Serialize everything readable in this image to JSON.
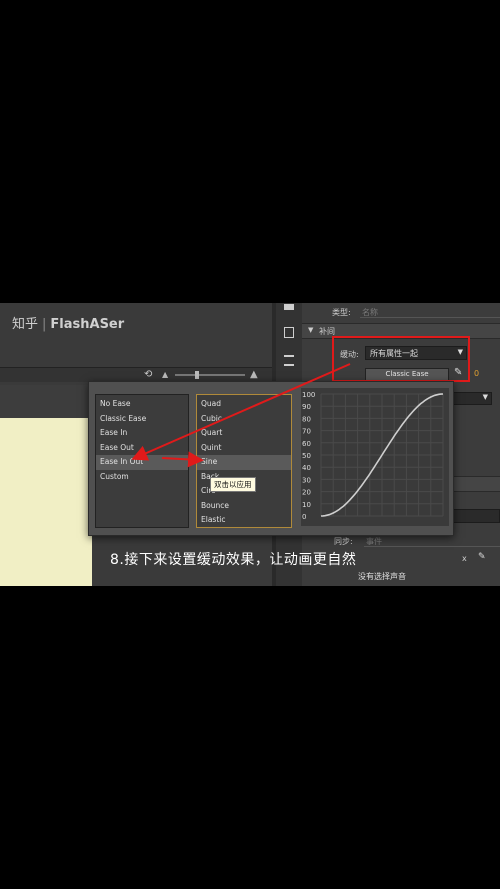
{
  "watermark": {
    "site": "知乎",
    "author": "FlashASer"
  },
  "properties": {
    "type_label": "类型:",
    "type_value": "名称",
    "section_label": "补间",
    "ease_label": "缓动:",
    "ease_value": "所有属性一起",
    "ease_button": "Classic Ease",
    "ease_amount": "0",
    "sync_label": "同步:",
    "sync_value": "事件",
    "x_label": "x",
    "no_sound": "没有选择声音"
  },
  "ease_popup": {
    "ease_types": [
      "No Ease",
      "Classic Ease",
      "Ease In",
      "Ease Out",
      "Ease In Out",
      "Custom"
    ],
    "selected_type": "Ease In Out",
    "curves": [
      "Quad",
      "Cubic",
      "Quart",
      "Quint",
      "Sine",
      "Back",
      "Circ",
      "Bounce",
      "Elastic"
    ],
    "selected_curve": "Sine",
    "tooltip": "双击以应用",
    "graph_labels": [
      "100",
      "90",
      "80",
      "70",
      "60",
      "50",
      "40",
      "30",
      "20",
      "10",
      "0"
    ]
  },
  "caption": "8.接下来设置缓动效果，让动画更自然",
  "colors": {
    "highlight": "#e01a1a",
    "accent": "#b08a3a",
    "stage": "#f1efc5"
  }
}
